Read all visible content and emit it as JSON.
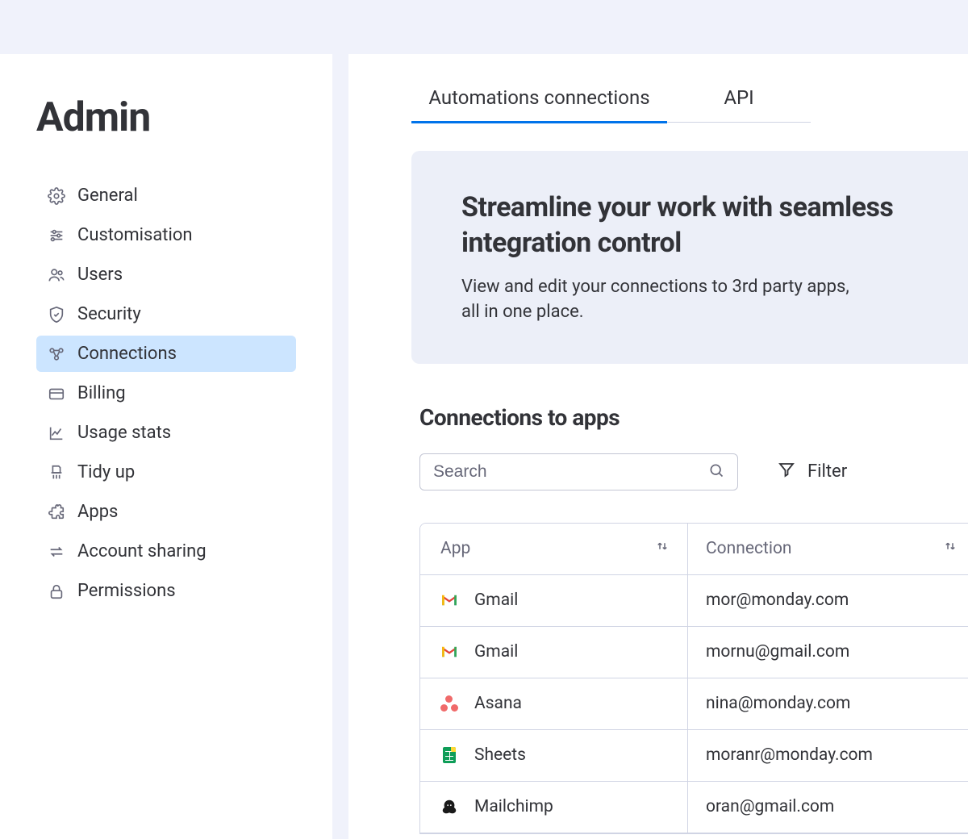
{
  "sidebar": {
    "title": "Admin",
    "items": [
      {
        "label": "General"
      },
      {
        "label": "Customisation"
      },
      {
        "label": "Users"
      },
      {
        "label": "Security"
      },
      {
        "label": "Connections"
      },
      {
        "label": "Billing"
      },
      {
        "label": "Usage stats"
      },
      {
        "label": "Tidy up"
      },
      {
        "label": "Apps"
      },
      {
        "label": "Account sharing"
      },
      {
        "label": "Permissions"
      }
    ]
  },
  "tabs": {
    "automations": "Automations connections",
    "api": "API"
  },
  "hero": {
    "title": "Streamline your work with seamless integration control",
    "subtitle": "View and edit your connections to 3rd party apps, all in one place."
  },
  "section": {
    "title": "Connections to apps"
  },
  "search": {
    "placeholder": "Search"
  },
  "filter": {
    "label": "Filter"
  },
  "table": {
    "headers": {
      "app": "App",
      "connection": "Connection"
    },
    "rows": [
      {
        "app": "Gmail",
        "connection": "mor@monday.com",
        "icon": "gmail"
      },
      {
        "app": "Gmail",
        "connection": "mornu@gmail.com",
        "icon": "gmail"
      },
      {
        "app": "Asana",
        "connection": "nina@monday.com",
        "icon": "asana"
      },
      {
        "app": "Sheets",
        "connection": "moranr@monday.com",
        "icon": "sheets"
      },
      {
        "app": "Mailchimp",
        "connection": "oran@gmail.com",
        "icon": "mailchimp"
      }
    ]
  }
}
